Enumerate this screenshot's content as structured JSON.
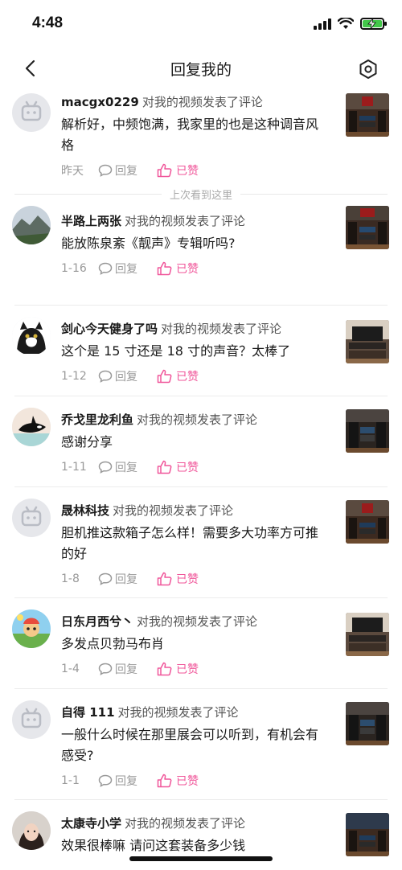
{
  "status_bar": {
    "time": "4:48"
  },
  "header": {
    "title": "回复我的"
  },
  "divider_label": "上次看到这里",
  "items": [
    {
      "username": "macgx0229",
      "action": "对我的视频发表了评论",
      "comment": "解析好，中频饱满，我家里的也是这种调音风格",
      "date": "昨天",
      "reply_label": "回复",
      "liked_label": "已赞",
      "avatar_type": "default"
    },
    {
      "username": "半路上两张",
      "action": "对我的视频发表了评论",
      "comment": "能放陈泉紊《靓声》专辑听吗?",
      "date": "1-16",
      "reply_label": "回复",
      "liked_label": "已赞",
      "avatar_type": "mountain"
    },
    {
      "username": "剑心今天健身了吗",
      "action": "对我的视频发表了评论",
      "comment": "这个是 15 寸还是 18 寸的声音？太棒了",
      "date": "1-12",
      "reply_label": "回复",
      "liked_label": "已赞",
      "avatar_type": "cat"
    },
    {
      "username": "乔戈里龙利鱼",
      "action": "对我的视频发表了评论",
      "comment": "感谢分享",
      "date": "1-11",
      "reply_label": "回复",
      "liked_label": "已赞",
      "avatar_type": "orca"
    },
    {
      "username": "晟林科技",
      "action": "对我的视频发表了评论",
      "comment": "胆机推这款箱子怎么样！需要多大功率方可推的好",
      "date": "1-8",
      "reply_label": "回复",
      "liked_label": "已赞",
      "avatar_type": "default"
    },
    {
      "username": "日东月西兮丶",
      "action": "对我的视频发表了评论",
      "comment": "多发点贝勃马布肖",
      "date": "1-4",
      "reply_label": "回复",
      "liked_label": "已赞",
      "avatar_type": "cartoon"
    },
    {
      "username": "自得 111",
      "action": "对我的视频发表了评论",
      "comment": "一般什么时候在那里展会可以听到，有机会有感受?",
      "date": "1-1",
      "reply_label": "回复",
      "liked_label": "已赞",
      "avatar_type": "default"
    },
    {
      "username": "太康寺小学",
      "action": "对我的视频发表了评论",
      "comment": "效果很棒嘛  请问这套装备多少钱",
      "date": "",
      "reply_label": "",
      "liked_label": "",
      "avatar_type": "person"
    }
  ]
}
